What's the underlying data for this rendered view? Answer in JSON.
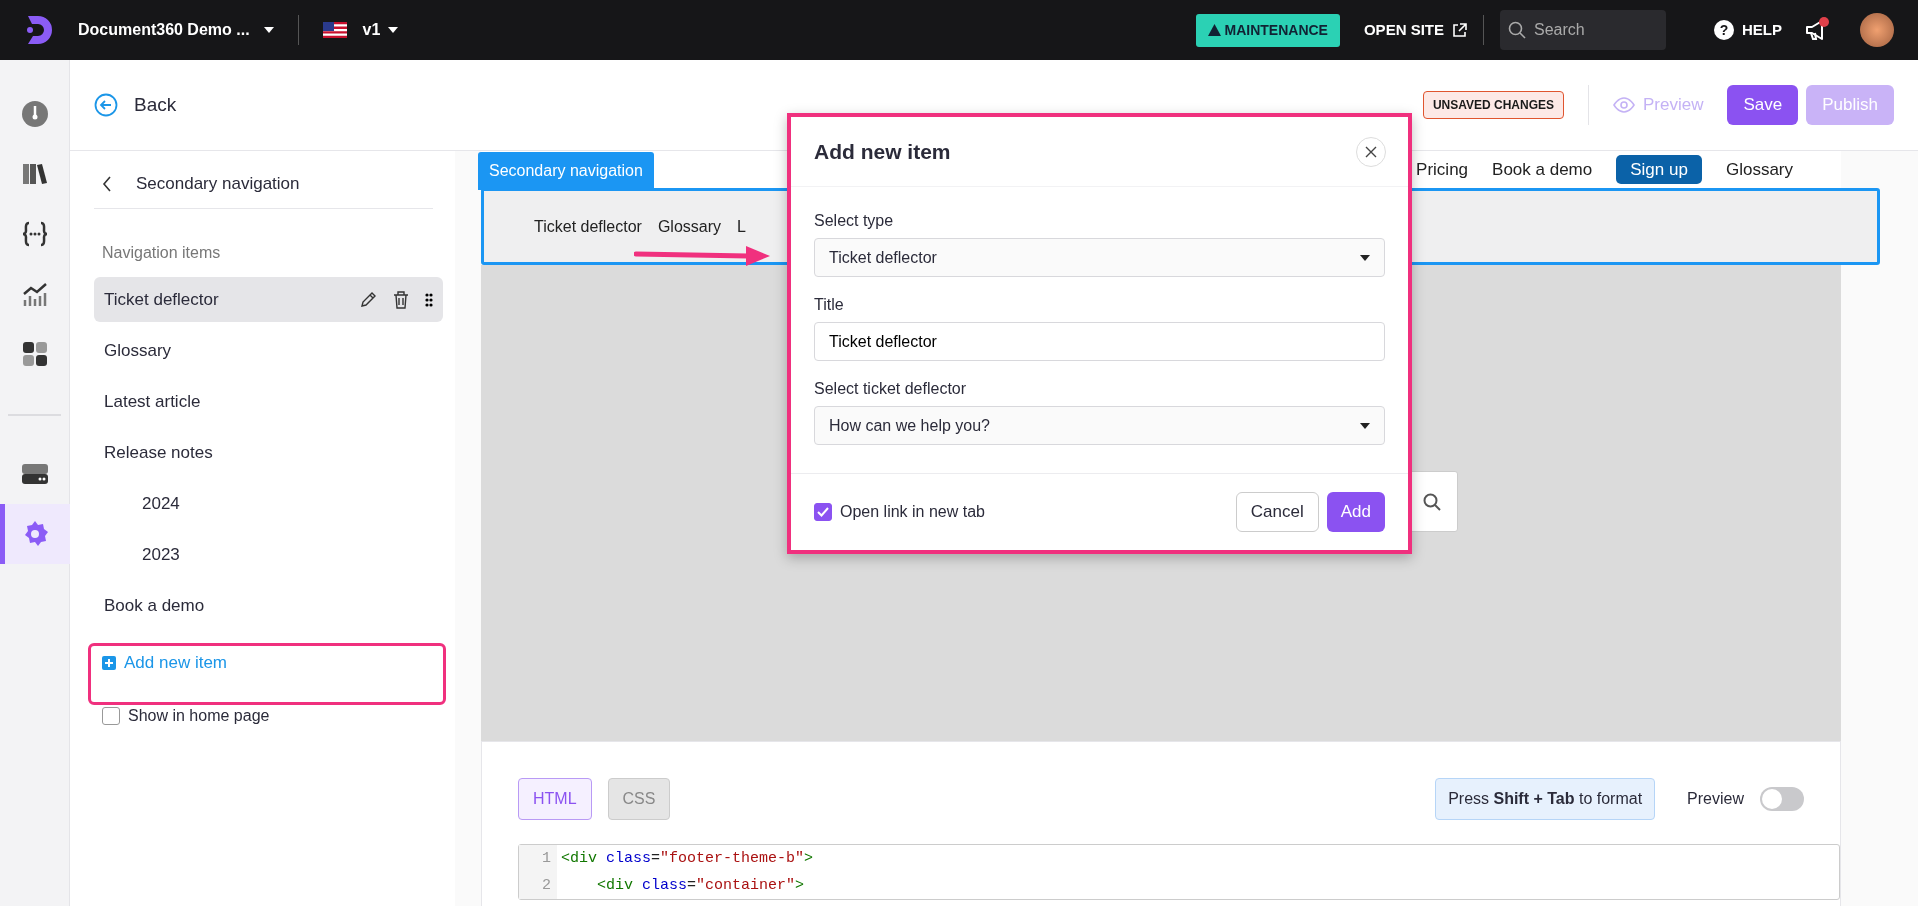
{
  "topbar": {
    "project": "Document360 Demo ...",
    "version": "v1",
    "maintenance": "MAINTENANCE",
    "open_site": "OPEN SITE",
    "search_placeholder": "Search",
    "help_glyph": "?",
    "help": "HELP"
  },
  "rail": [
    {
      "kind": "gauge",
      "selected": false
    },
    {
      "kind": "books",
      "selected": false
    },
    {
      "kind": "braces",
      "selected": false
    },
    {
      "kind": "chart",
      "selected": false
    },
    {
      "kind": "grid",
      "selected": false
    },
    {
      "kind": "divider"
    },
    {
      "kind": "drive",
      "selected": false
    },
    {
      "kind": "gear",
      "selected": true
    }
  ],
  "header": {
    "back": "Back",
    "badge": "UNSAVED CHANGES",
    "preview": "Preview",
    "save": "Save",
    "publish": {
      "label": "Publish",
      "disabled": true
    }
  },
  "panel": {
    "title": "Secondary navigation",
    "section": "Navigation items",
    "items": [
      {
        "label": "Ticket deflector",
        "selected": true
      },
      {
        "label": "Glossary",
        "selected": false
      },
      {
        "label": "Latest article",
        "selected": false
      },
      {
        "label": "Release notes",
        "selected": false,
        "children": [
          {
            "label": "2024",
            "selected": false
          },
          {
            "label": "2023",
            "selected": false
          }
        ]
      },
      {
        "label": "Book a demo",
        "selected": false
      }
    ],
    "add_item": "Add new item",
    "show_home": {
      "label": "Show in home page",
      "checked": false
    }
  },
  "site_preview": {
    "top_nav": [
      {
        "label": "Pricing",
        "kind": "link"
      },
      {
        "label": "Book a demo",
        "kind": "link"
      },
      {
        "label": "Sign up",
        "kind": "button"
      },
      {
        "label": "Glossary",
        "kind": "link"
      }
    ],
    "tab_label": "Secondary navigation",
    "secondary_items": [
      "Ticket deflector",
      "Glossary",
      "L"
    ]
  },
  "modal": {
    "title": "Add new item",
    "fields": [
      {
        "kind": "select",
        "label": "Select type",
        "value": "Ticket deflector"
      },
      {
        "kind": "text",
        "label": "Title",
        "value": "Ticket deflector"
      },
      {
        "kind": "select",
        "label": "Select ticket deflector",
        "value": "How can we help you?"
      }
    ],
    "open_new_tab": {
      "label": "Open link in new tab",
      "checked": true
    },
    "buttons": [
      {
        "label": "Cancel",
        "kind": "secondary"
      },
      {
        "label": "Add",
        "kind": "primary"
      }
    ]
  },
  "editor": {
    "tabs": [
      {
        "label": "HTML",
        "selected": true
      },
      {
        "label": "CSS",
        "selected": false
      }
    ],
    "hint": "Press **Shift + Tab** to format",
    "preview_toggle": {
      "label": "Preview",
      "on": false
    },
    "lines": [
      {
        "number": "1",
        "indent": false,
        "tokens": [
          {
            "kind": "tag",
            "text": "<div"
          },
          {
            "kind": "attr",
            "text": " class"
          },
          {
            "kind": "punct",
            "text": "="
          },
          {
            "kind": "string",
            "text": "\"footer-theme-b\""
          },
          {
            "kind": "tag",
            "text": ">"
          }
        ]
      },
      {
        "number": "2",
        "indent": true,
        "tokens": [
          {
            "kind": "tag",
            "text": "<div"
          },
          {
            "kind": "attr",
            "text": " class"
          },
          {
            "kind": "punct",
            "text": "="
          },
          {
            "kind": "string",
            "text": "\"container\""
          },
          {
            "kind": "tag",
            "text": ">"
          }
        ]
      }
    ]
  }
}
